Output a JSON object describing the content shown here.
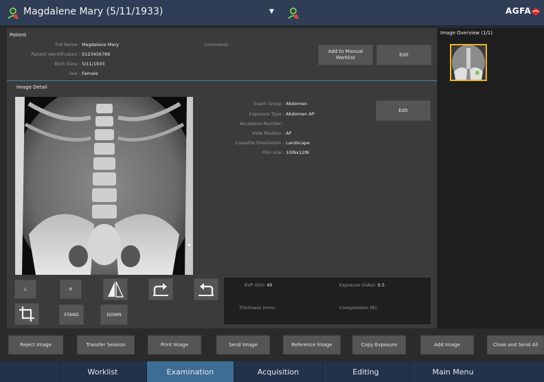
{
  "header": {
    "title": "Magdalene Mary (5/11/1933)",
    "dropdown_glyph": "▼",
    "brand": "AGFA",
    "icons": [
      "patient-icon",
      "patient-alert-icon",
      "agfa-logo-icon"
    ],
    "accent": "#2f3d56"
  },
  "patient": {
    "section_label": "Patient",
    "fields": [
      {
        "label": "Full Name :",
        "value": "Magdalene Mary"
      },
      {
        "label": "Patient Identification :",
        "value": "0123456789"
      },
      {
        "label": "Birth Date :",
        "value": "5/11/1933"
      },
      {
        "label": "Sex :",
        "value": "Female"
      }
    ],
    "comments_label": "Comments :",
    "add_worklist_label": "Add to Manual Worklist",
    "edit_label": "Edit"
  },
  "image_detail": {
    "section_label": "Image Detail",
    "fields": [
      {
        "label": "Exam Group :",
        "value": "Abdomen"
      },
      {
        "label": "Exposure Type :",
        "value": "Abdomen AP"
      },
      {
        "label": "Accession Number :",
        "value": ""
      },
      {
        "label": "View Position :",
        "value": "AP"
      },
      {
        "label": "Cassette Orientation :",
        "value": "Landscape"
      },
      {
        "label": "Film size :",
        "value": "10INx12IN"
      }
    ],
    "edit_label": "Edit"
  },
  "tools": {
    "left_label": "L",
    "right_label": "R",
    "stand_label": "STAND",
    "down_label": "DOWN",
    "icons": [
      "flip-horizontal-icon",
      "rotate-right-icon",
      "rotate-left-icon",
      "crop-icon"
    ]
  },
  "exposure": {
    "kvp_label": "KVP (kV):",
    "kvp_value": "40",
    "mas_label": "Exposure (mAs):",
    "mas_value": "0.5",
    "thickness_label": "Thickness (mm):",
    "compression_label": "Compression (N):"
  },
  "overview": {
    "label": "Image Overview (1/1)",
    "selected_color": "#f0b428"
  },
  "actions": {
    "reject": "Reject Image",
    "transfer": "Transfer Session",
    "print": "Print Image",
    "send": "Send Image",
    "reference": "Reference Image",
    "copy": "Copy Exposure",
    "add": "Add Image",
    "close_send": "Close and Send All"
  },
  "nav": {
    "tabs": [
      {
        "label": "Worklist",
        "active": false
      },
      {
        "label": "Examination",
        "active": true
      },
      {
        "label": "Acquisition",
        "active": false
      },
      {
        "label": "Editing",
        "active": false
      },
      {
        "label": "Main Menu",
        "active": false
      }
    ],
    "active_color": "#3d6d94"
  }
}
